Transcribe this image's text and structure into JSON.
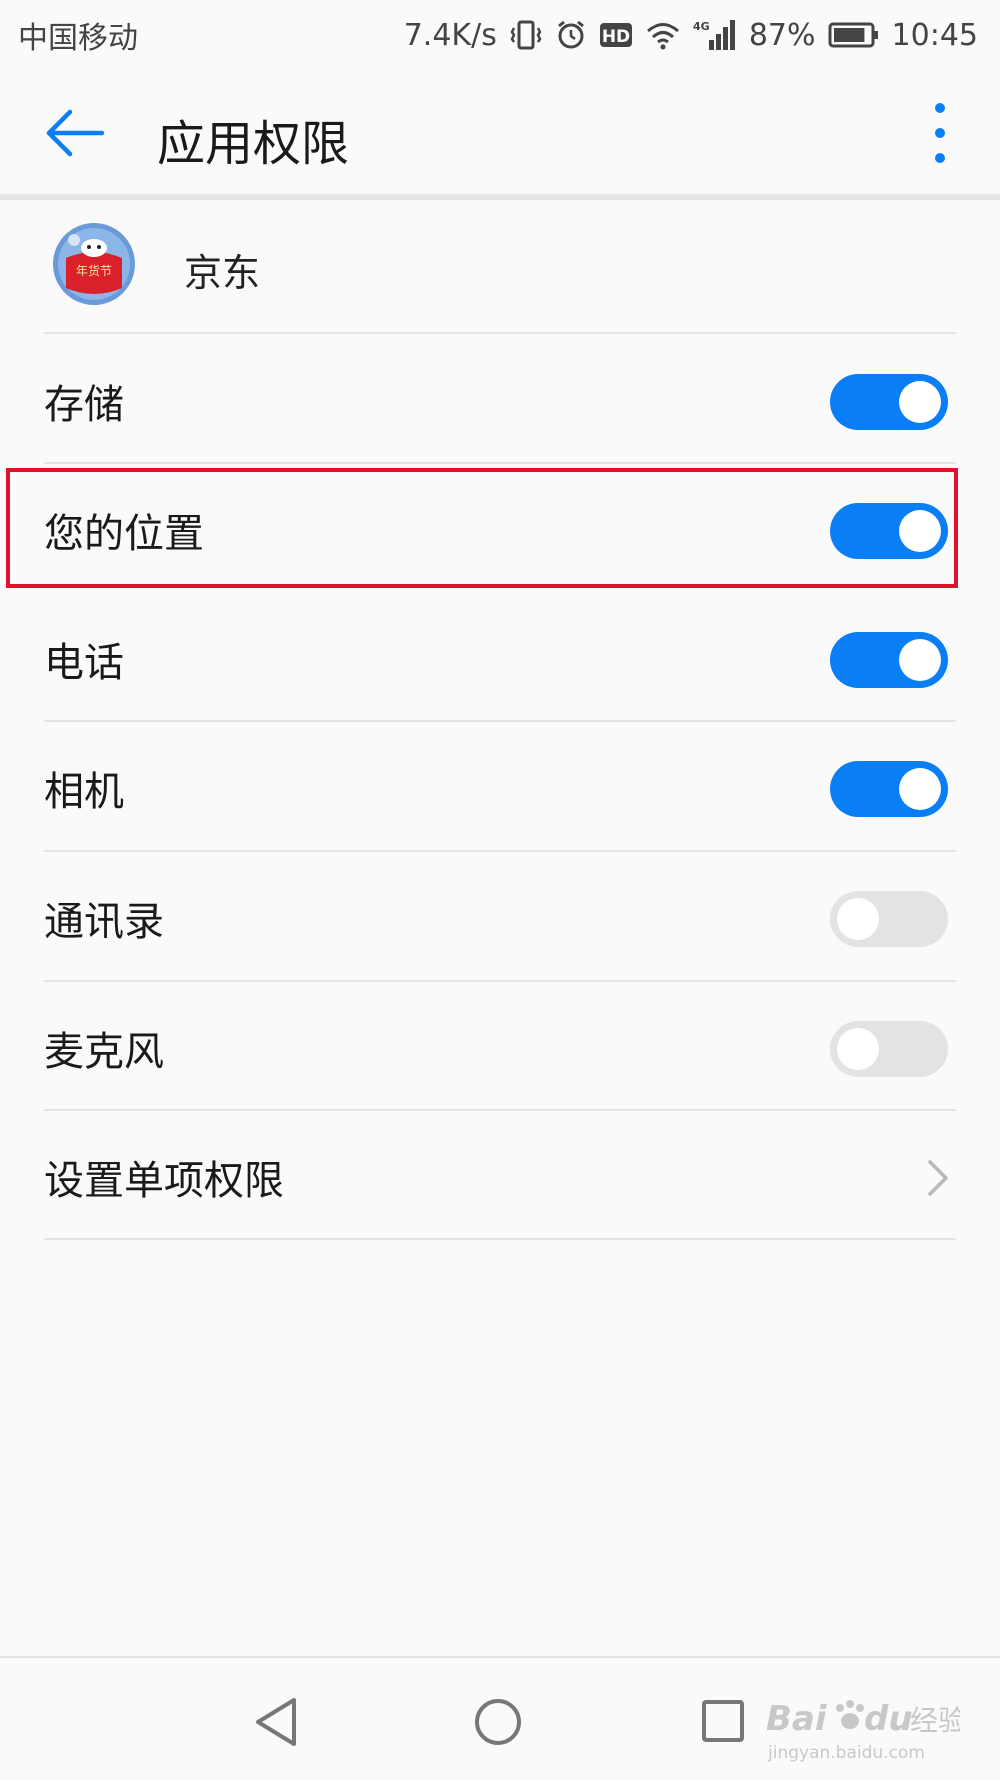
{
  "status_bar": {
    "carrier": "中国移动",
    "speed": "7.4K/s",
    "hd": "HD",
    "network": "4G",
    "battery_percent": "87%",
    "battery_level": 0.87,
    "time": "10:45"
  },
  "app_bar": {
    "title": "应用权限"
  },
  "app": {
    "name": "京东",
    "icon_text": "年货节"
  },
  "permissions": [
    {
      "label": "存储",
      "enabled": true
    },
    {
      "label": "您的位置",
      "enabled": true,
      "highlighted": true
    },
    {
      "label": "电话",
      "enabled": true
    },
    {
      "label": "相机",
      "enabled": true
    },
    {
      "label": "通讯录",
      "enabled": false
    },
    {
      "label": "麦克风",
      "enabled": false
    }
  ],
  "individual_permissions_label": "设置单项权限",
  "watermark": {
    "brand": "Bai",
    "brand2": "du",
    "suffix": "经验",
    "url": "jingyan.baidu.com"
  },
  "colors": {
    "accent": "#0a7ff5",
    "highlight": "#e3122c",
    "toggle_off": "#e3e3e3"
  }
}
